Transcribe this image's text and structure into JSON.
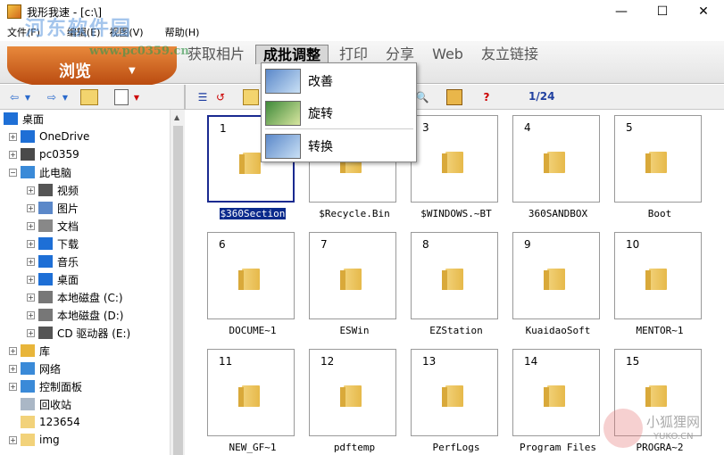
{
  "window": {
    "title": "我形我速 - [c:\\]",
    "minimize": "—",
    "maximize": "☐",
    "close": "✕"
  },
  "watermark": {
    "site_name": "河东软件园",
    "url": "www.pc0359.cn",
    "corner_name": "小狐狸网",
    "corner_url": "YUKO.CN"
  },
  "menubar": [
    "文件(F)",
    "编辑(E)",
    "视图(V)",
    "帮助(H)"
  ],
  "ribbon": {
    "browse_label": "浏览",
    "tabs": [
      "获取相片",
      "成批调整",
      "打印",
      "分享",
      "Web",
      "友立链接"
    ],
    "active_tab": "成批调整"
  },
  "dropdown": {
    "items": [
      "改善",
      "旋转",
      "转换"
    ]
  },
  "toolbar": {
    "page_indicator": "1/24"
  },
  "tree": {
    "items": [
      {
        "label": "桌面",
        "level": 0,
        "icon": "desktop-icon",
        "expander": ""
      },
      {
        "label": "OneDrive",
        "level": 1,
        "icon": "cloud-icon",
        "expander": "+"
      },
      {
        "label": "pc0359",
        "level": 1,
        "icon": "user-icon",
        "expander": "+"
      },
      {
        "label": "此电脑",
        "level": 1,
        "icon": "computer-icon",
        "expander": "−"
      },
      {
        "label": "视频",
        "level": 2,
        "icon": "video-icon",
        "expander": "+"
      },
      {
        "label": "图片",
        "level": 2,
        "icon": "pictures-icon",
        "expander": "+"
      },
      {
        "label": "文档",
        "level": 2,
        "icon": "documents-icon",
        "expander": "+"
      },
      {
        "label": "下载",
        "level": 2,
        "icon": "download-icon",
        "expander": "+"
      },
      {
        "label": "音乐",
        "level": 2,
        "icon": "music-icon",
        "expander": "+"
      },
      {
        "label": "桌面",
        "level": 2,
        "icon": "desktop-icon",
        "expander": "+"
      },
      {
        "label": "本地磁盘 (C:)",
        "level": 2,
        "icon": "drive-icon",
        "expander": "+"
      },
      {
        "label": "本地磁盘 (D:)",
        "level": 2,
        "icon": "drive-icon",
        "expander": "+"
      },
      {
        "label": "CD 驱动器 (E:)",
        "level": 2,
        "icon": "cd-icon",
        "expander": "+"
      },
      {
        "label": "库",
        "level": 1,
        "icon": "library-icon",
        "expander": "+"
      },
      {
        "label": "网络",
        "level": 1,
        "icon": "network-icon",
        "expander": "+"
      },
      {
        "label": "控制面板",
        "level": 1,
        "icon": "control-panel-icon",
        "expander": "+"
      },
      {
        "label": "回收站",
        "level": 1,
        "icon": "recycle-bin-icon",
        "expander": ""
      },
      {
        "label": "123654",
        "level": 1,
        "icon": "folder-icon",
        "expander": ""
      },
      {
        "label": "img",
        "level": 1,
        "icon": "folder-icon",
        "expander": "+"
      }
    ]
  },
  "thumbnails": [
    {
      "num": "1",
      "name": "$360Section",
      "selected": true
    },
    {
      "num": "2",
      "name": "$Recycle.Bin",
      "selected": false
    },
    {
      "num": "3",
      "name": "$WINDOWS.~BT",
      "selected": false
    },
    {
      "num": "4",
      "name": "360SANDBOX",
      "selected": false
    },
    {
      "num": "5",
      "name": "Boot",
      "selected": false
    },
    {
      "num": "6",
      "name": "DOCUME~1",
      "selected": false
    },
    {
      "num": "7",
      "name": "ESWin",
      "selected": false
    },
    {
      "num": "8",
      "name": "EZStation",
      "selected": false
    },
    {
      "num": "9",
      "name": "KuaidaoSoft",
      "selected": false
    },
    {
      "num": "10",
      "name": "MENTOR~1",
      "selected": false
    },
    {
      "num": "11",
      "name": "NEW_GF~1",
      "selected": false
    },
    {
      "num": "12",
      "name": "pdftemp",
      "selected": false
    },
    {
      "num": "13",
      "name": "PerfLogs",
      "selected": false
    },
    {
      "num": "14",
      "name": "Program Files",
      "selected": false
    },
    {
      "num": "15",
      "name": "PROGRA~2",
      "selected": false
    }
  ]
}
